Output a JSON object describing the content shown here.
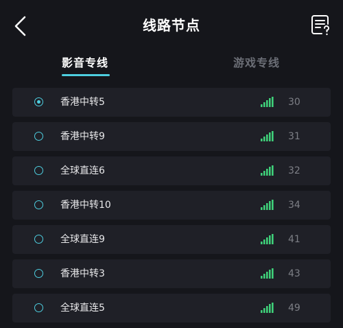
{
  "header": {
    "title": "线路节点",
    "back_icon": "chevron-left-icon",
    "doc_icon": "document-question-icon"
  },
  "tabs": [
    {
      "label": "影音专线",
      "active": true
    },
    {
      "label": "游戏专线",
      "active": false
    }
  ],
  "colors": {
    "accent": "#4ecfe0",
    "signal": "#3fd17a",
    "background": "#15161b",
    "row_background": "#1f2027"
  },
  "nodes": [
    {
      "name": "香港中转5",
      "latency": "30",
      "selected": true,
      "signal_icon": "signal-bars-icon"
    },
    {
      "name": "香港中转9",
      "latency": "31",
      "selected": false,
      "signal_icon": "signal-bars-icon"
    },
    {
      "name": "全球直连6",
      "latency": "32",
      "selected": false,
      "signal_icon": "signal-bars-icon"
    },
    {
      "name": "香港中转10",
      "latency": "34",
      "selected": false,
      "signal_icon": "signal-bars-icon"
    },
    {
      "name": "全球直连9",
      "latency": "41",
      "selected": false,
      "signal_icon": "signal-bars-icon"
    },
    {
      "name": "香港中转3",
      "latency": "43",
      "selected": false,
      "signal_icon": "signal-bars-icon"
    },
    {
      "name": "全球直连5",
      "latency": "49",
      "selected": false,
      "signal_icon": "signal-bars-icon"
    }
  ]
}
